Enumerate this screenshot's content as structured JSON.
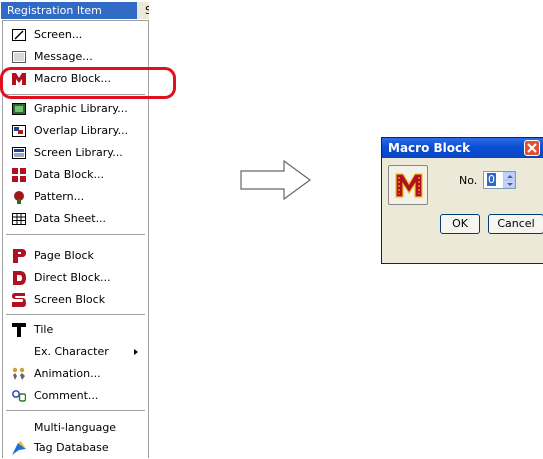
{
  "menubar": {
    "active_label": "Registration Item",
    "next_label": "Screen"
  },
  "menu": {
    "items": [
      {
        "label": "Screen...",
        "icon": "screen-icon"
      },
      {
        "label": "Message...",
        "icon": "message-icon"
      },
      {
        "label": "Macro Block...",
        "icon": "macro-block-icon"
      },
      {
        "label": "Graphic Library...",
        "icon": "graphic-library-icon"
      },
      {
        "label": "Overlap Library...",
        "icon": "overlap-library-icon"
      },
      {
        "label": "Screen Library...",
        "icon": "screen-library-icon"
      },
      {
        "label": "Data Block...",
        "icon": "data-block-icon"
      },
      {
        "label": "Pattern...",
        "icon": "pattern-icon"
      },
      {
        "label": "Data Sheet...",
        "icon": "data-sheet-icon"
      },
      {
        "label": "Page Block",
        "icon": "page-block-icon"
      },
      {
        "label": "Direct Block...",
        "icon": "direct-block-icon"
      },
      {
        "label": "Screen Block",
        "icon": "screen-block-icon"
      },
      {
        "label": "Tile",
        "icon": "tile-icon"
      },
      {
        "label": "Ex. Character",
        "icon": ""
      },
      {
        "label": "Animation...",
        "icon": "animation-icon"
      },
      {
        "label": "Comment...",
        "icon": "comment-icon"
      },
      {
        "label": "Multi-language",
        "icon": ""
      },
      {
        "label": "Tag Database",
        "icon": "tag-database-icon"
      }
    ]
  },
  "dialog": {
    "title": "Macro Block",
    "no_label": "No.",
    "no_value": "0",
    "ok_label": "OK",
    "cancel_label": "Cancel"
  },
  "colors": {
    "highlight": "#e0101e",
    "selection": "#316ac5",
    "titlebar": "#0a4fd4"
  }
}
